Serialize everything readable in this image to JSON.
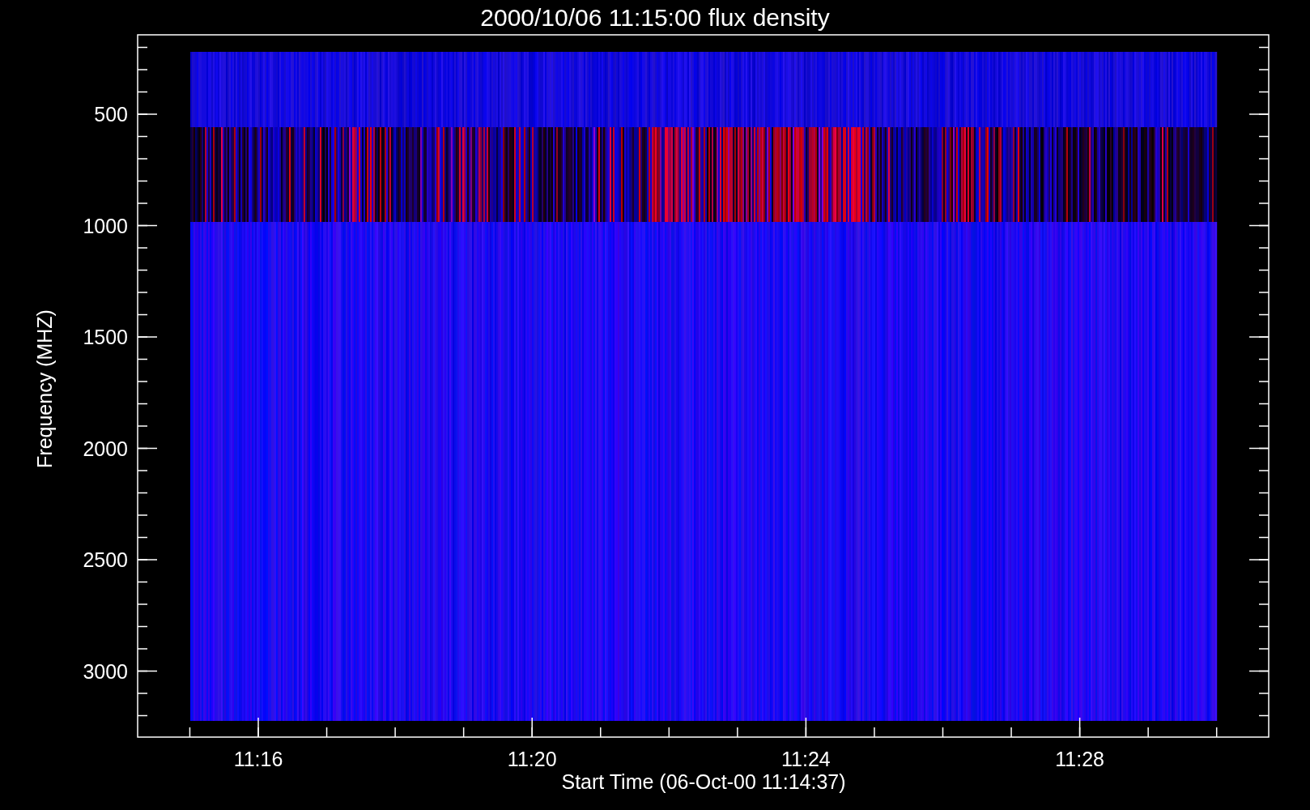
{
  "title": "2000/10/06 11:15:00 flux density",
  "y_axis": {
    "label": "Frequency (MHZ)",
    "ticks": [
      "500",
      "1000",
      "1500",
      "2000",
      "2500",
      "3000"
    ]
  },
  "x_axis": {
    "label": "Start Time (06-Oct-00 11:14:37)",
    "ticks": [
      "11:16",
      "11:20",
      "11:24",
      "11:28"
    ]
  }
}
